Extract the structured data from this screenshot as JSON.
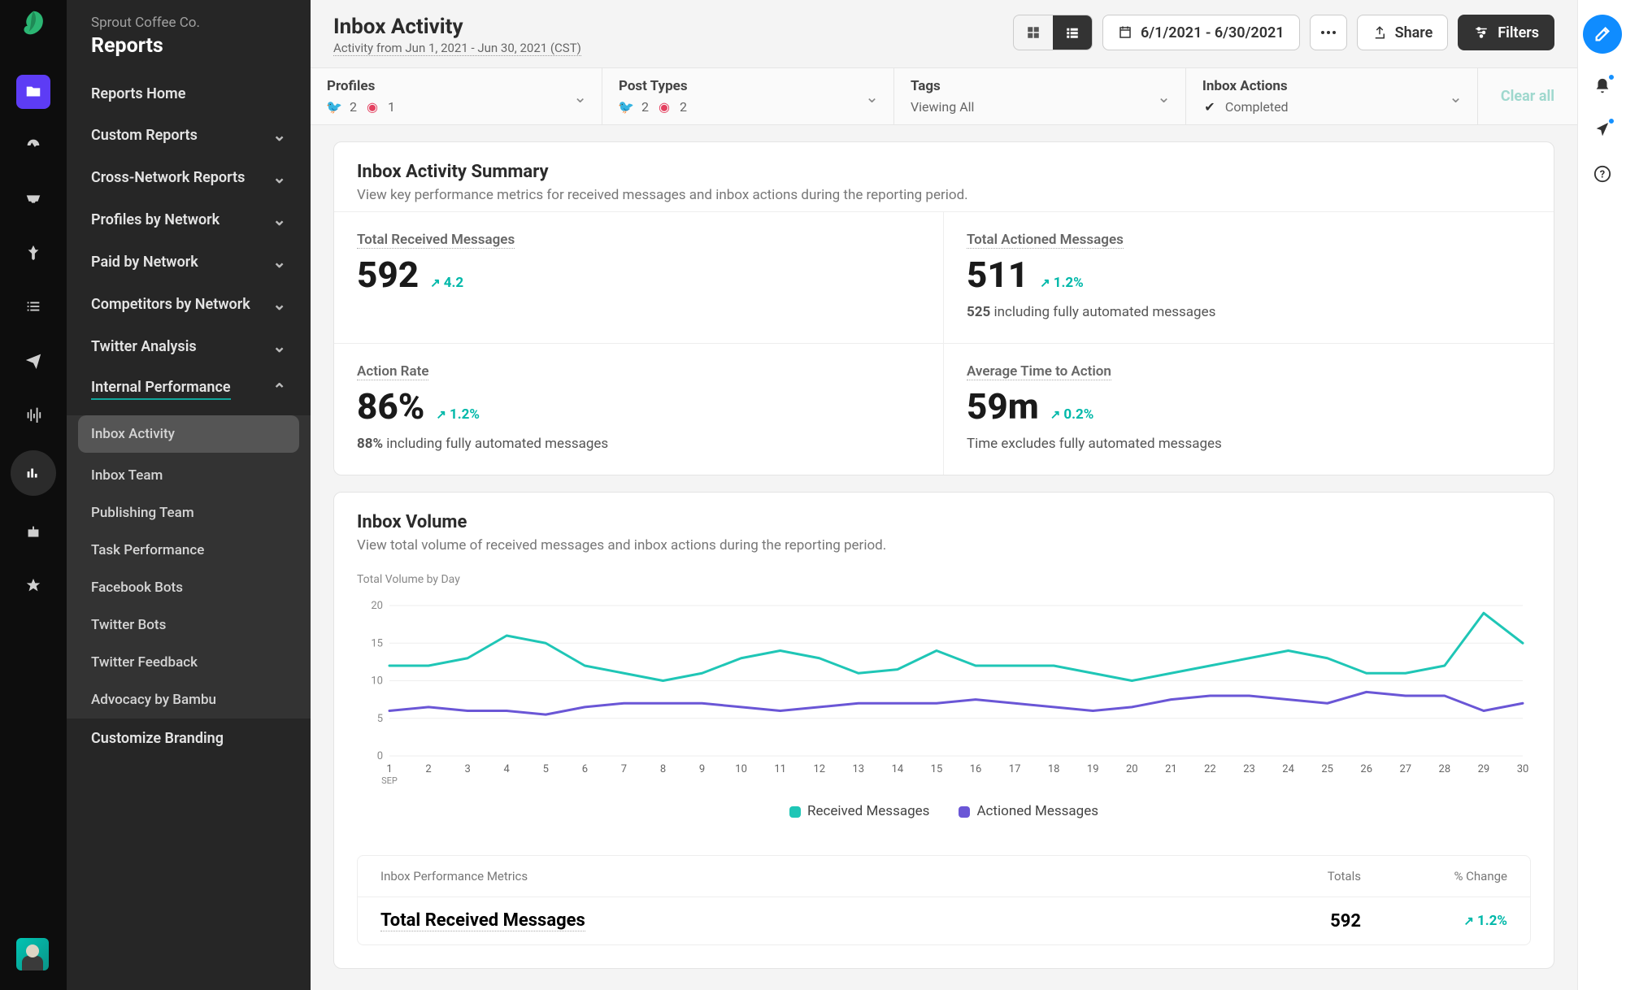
{
  "company": "Sprout Coffee Co.",
  "section": "Reports",
  "sidebar": {
    "home": "Reports Home",
    "groups": [
      "Custom Reports",
      "Cross-Network Reports",
      "Profiles by Network",
      "Paid by Network",
      "Competitors by Network",
      "Twitter Analysis",
      "Internal Performance"
    ],
    "subitems": [
      "Inbox Activity",
      "Inbox Team",
      "Publishing Team",
      "Task Performance",
      "Facebook Bots",
      "Twitter Bots",
      "Twitter Feedback",
      "Advocacy by Bambu"
    ],
    "customize": "Customize Branding"
  },
  "header": {
    "title": "Inbox Activity",
    "subtitle": "Activity from Jun 1, 2021 - Jun 30, 2021 (CST)",
    "daterange": "6/1/2021 - 6/30/2021",
    "share": "Share",
    "filters": "Filters"
  },
  "filters": {
    "profiles": {
      "label": "Profiles",
      "tw": "2",
      "ig": "1"
    },
    "post_types": {
      "label": "Post Types",
      "tw": "2",
      "ig": "2"
    },
    "tags": {
      "label": "Tags",
      "status": "Viewing All"
    },
    "inbox_actions": {
      "label": "Inbox Actions",
      "status": "Completed"
    },
    "clear": "Clear all"
  },
  "summary": {
    "title": "Inbox Activity Summary",
    "desc": "View key performance metrics for received messages and inbox actions during the reporting period.",
    "m1": {
      "label": "Total Received Messages",
      "value": "592",
      "delta": "4.2"
    },
    "m2": {
      "label": "Total Actioned Messages",
      "value": "511",
      "delta": "1.2%",
      "sub_b": "525",
      "sub_t": "including fully automated messages"
    },
    "m3": {
      "label": "Action Rate",
      "value": "86%",
      "delta": "1.2%",
      "sub_b": "88%",
      "sub_t": "including fully automated messages"
    },
    "m4": {
      "label": "Average Time to Action",
      "value": "59m",
      "delta": "0.2%",
      "sub": "Time excludes fully automated messages"
    }
  },
  "volume": {
    "title": "Inbox Volume",
    "desc": "View total volume of received messages and inbox actions during the reporting period.",
    "subtitle": "Total Volume by Day",
    "legend_a": "Received Messages",
    "legend_b": "Actioned Messages",
    "x_month": "SEP"
  },
  "table": {
    "header": {
      "col1": "Inbox Performance Metrics",
      "col2": "Totals",
      "col3": "% Change"
    },
    "row1": {
      "name": "Total Received Messages",
      "value": "592",
      "change": "1.2%"
    }
  },
  "chart_data": {
    "type": "line",
    "title": "Total Volume by Day",
    "xlabel": "Day (SEP)",
    "ylabel": "",
    "ylim": [
      0,
      20
    ],
    "yticks": [
      0,
      5,
      10,
      15,
      20
    ],
    "categories": [
      1,
      2,
      3,
      4,
      5,
      6,
      7,
      8,
      9,
      10,
      11,
      12,
      13,
      14,
      15,
      16,
      17,
      18,
      19,
      20,
      21,
      22,
      23,
      24,
      25,
      26,
      27,
      28,
      29,
      30
    ],
    "series": [
      {
        "name": "Received Messages",
        "color": "#1fc6b6",
        "values": [
          12,
          12,
          13,
          16,
          15,
          12,
          11,
          10,
          11,
          13,
          14,
          13,
          11,
          11.5,
          14,
          12,
          12,
          12,
          11,
          10,
          11,
          12,
          13,
          14,
          13,
          11,
          11,
          12,
          19,
          15
        ]
      },
      {
        "name": "Actioned Messages",
        "color": "#6a56d6",
        "values": [
          6,
          6.5,
          6,
          6,
          5.5,
          6.5,
          7,
          7,
          7,
          6.5,
          6,
          6.5,
          7,
          7,
          7,
          7.5,
          7,
          6.5,
          6,
          6.5,
          7.5,
          8,
          8,
          7.5,
          7,
          8.5,
          8,
          8,
          6,
          7
        ]
      }
    ]
  }
}
